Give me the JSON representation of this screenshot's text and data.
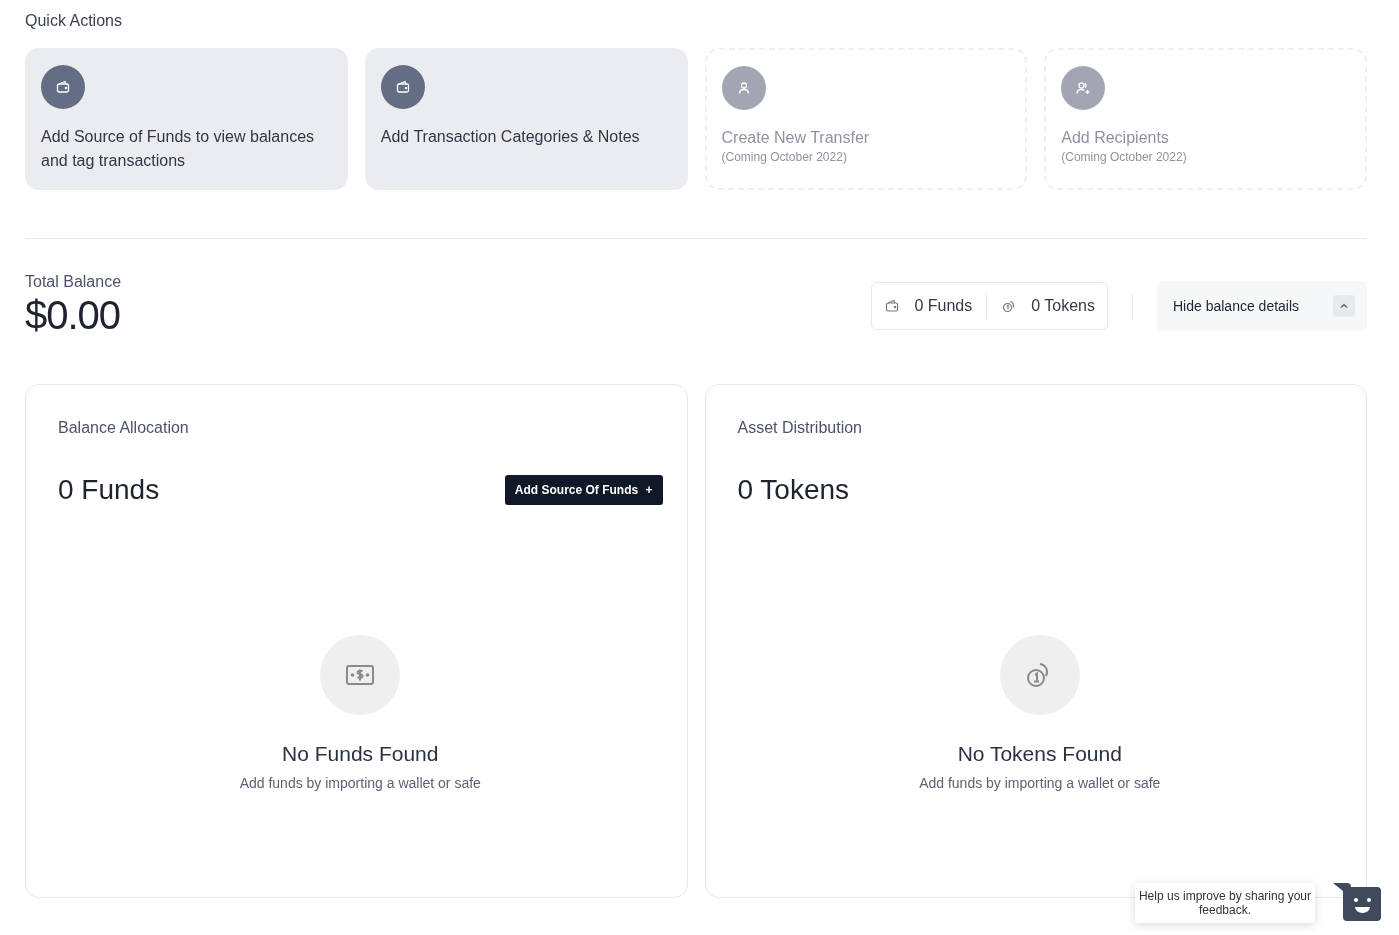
{
  "quick_actions": {
    "title": "Quick Actions",
    "cards": [
      {
        "kind": "active",
        "title": "Add Source of Funds to view balances and tag transactions"
      },
      {
        "kind": "active",
        "title": "Add Transaction Categories & Notes"
      },
      {
        "kind": "disabled",
        "title": "Create New Transfer",
        "note": "(Coming October 2022)"
      },
      {
        "kind": "disabled",
        "title": "Add Recipients",
        "note": "(Coming October 2022)"
      }
    ]
  },
  "balance": {
    "label": "Total Balance",
    "amount": "$0.00",
    "funds": "0 Funds",
    "tokens": "0 Tokens",
    "toggle": "Hide balance details",
    "expanded": true
  },
  "panels": [
    {
      "kind": "funds",
      "title": "Balance Allocation",
      "count": "0 Funds",
      "button": "Add Source Of Funds",
      "button_icon": "+",
      "empty_title": "No Funds Found",
      "empty_text": "Add funds by importing a wallet or safe"
    },
    {
      "kind": "tokens",
      "title": "Asset Distribution",
      "count": "0 Tokens",
      "empty_title": "No Tokens Found",
      "empty_text": "Add funds by importing a wallet or safe"
    }
  ],
  "feedback": {
    "text": "Help us improve by sharing your feedback."
  }
}
